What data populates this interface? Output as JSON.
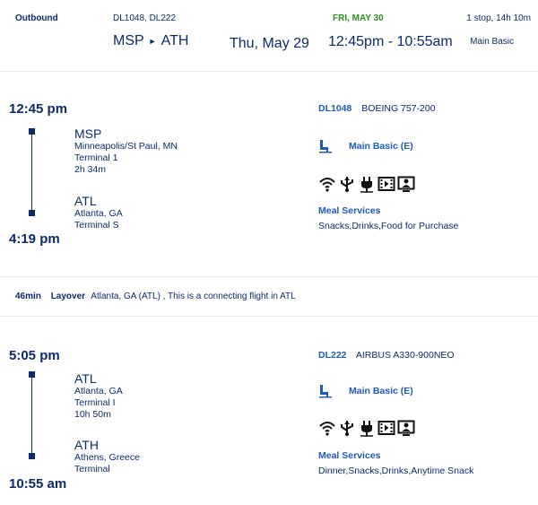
{
  "header": {
    "direction": "Outbound",
    "flight_numbers": "DL1048, DL222",
    "arrival_date": "FRI, MAY 30",
    "stops_duration": "1 stop, 14h 10m",
    "origin": "MSP",
    "destination": "ATH",
    "departure_date": "Thu, May 29",
    "times": "12:45pm - 10:55am",
    "cabin": "Main Basic"
  },
  "segments": [
    {
      "dep_time": "12:45 pm",
      "arr_time": "4:19 pm",
      "origin": {
        "code": "MSP",
        "city": "Minneapolis/St Paul, MN",
        "terminal": "Terminal 1",
        "duration": "2h 34m"
      },
      "destination": {
        "code": "ATL",
        "city": "Atlanta, GA",
        "terminal": "Terminal S"
      },
      "flight_number": "DL1048",
      "aircraft": "BOEING 757-200",
      "cabin": "Main Basic (E)",
      "meal_title": "Meal Services",
      "meals": "Snacks,Drinks,Food for Purchase",
      "amenities": [
        "wifi-icon",
        "usb-power-icon",
        "ac-power-icon",
        "video-icon",
        "seatback-screen-icon"
      ]
    },
    {
      "dep_time": "5:05 pm",
      "arr_time": "10:55 am",
      "origin": {
        "code": "ATL",
        "city": "Atlanta, GA",
        "terminal": "Terminal I",
        "duration": "10h 50m"
      },
      "destination": {
        "code": "ATH",
        "city": "Athens, Greece",
        "terminal": "Terminal"
      },
      "flight_number": "DL222",
      "aircraft": "AIRBUS A330-900NEO",
      "cabin": "Main Basic (E)",
      "meal_title": "Meal Services",
      "meals": "Dinner,Snacks,Drinks,Anytime Snack",
      "amenities": [
        "wifi-icon",
        "usb-power-icon",
        "ac-power-icon",
        "video-icon",
        "seatback-screen-icon"
      ]
    }
  ],
  "layover": {
    "duration": "46min",
    "label": "Layover",
    "description": "Atlanta, GA (ATL) , This is a connecting flight in ATL"
  },
  "colors": {
    "navy": "#0d2a6b",
    "blue": "#1f5bb5",
    "green": "#2e8b1f"
  }
}
